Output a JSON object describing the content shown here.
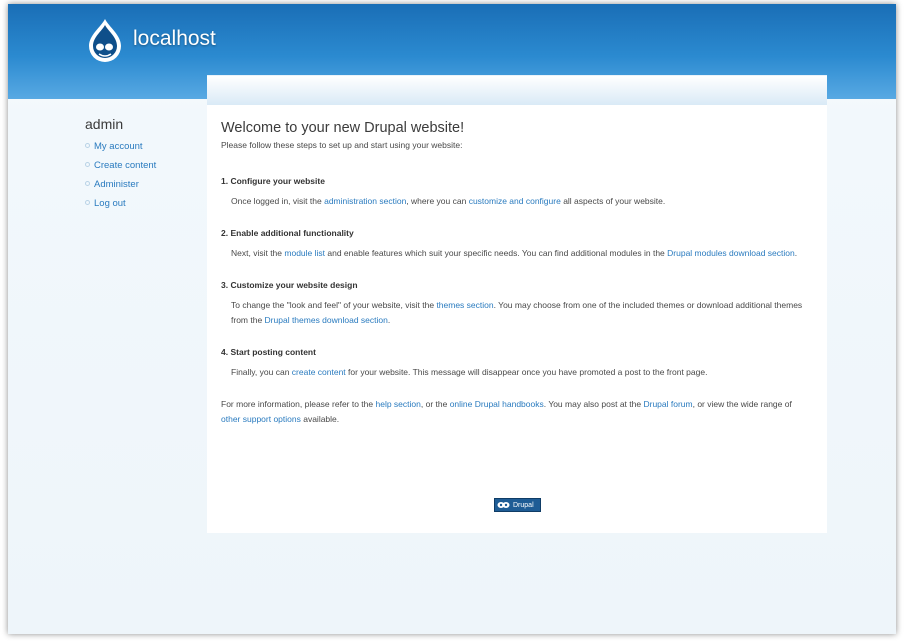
{
  "header": {
    "site_name": "localhost"
  },
  "sidebar": {
    "user": "admin",
    "items": [
      {
        "label": "My account"
      },
      {
        "label": "Create content"
      },
      {
        "label": "Administer"
      },
      {
        "label": "Log out"
      }
    ]
  },
  "main": {
    "title": "Welcome to your new Drupal website!",
    "intro": "Please follow these steps to set up and start using your website:",
    "steps": [
      {
        "number": "1.",
        "title": "Configure your website",
        "t1": "Once logged in, visit the ",
        "l1": "administration section",
        "t2": ", where you can ",
        "l2": "customize and configure",
        "t3": " all aspects of your website."
      },
      {
        "number": "2.",
        "title": "Enable additional functionality",
        "t1": "Next, visit the ",
        "l1": "module list",
        "t2": " and enable features which suit your specific needs. You can find additional modules in the ",
        "l2": "Drupal modules download section",
        "t3": "."
      },
      {
        "number": "3.",
        "title": "Customize your website design",
        "t1": "To change the \"look and feel\" of your website, visit the ",
        "l1": "themes section",
        "t2": ". You may choose from one of the included themes or download additional themes from the ",
        "l2": "Drupal themes download section",
        "t3": "."
      },
      {
        "number": "4.",
        "title": "Start posting content",
        "t1": "Finally, you can ",
        "l1": "create content",
        "t2": " for your website. This message will disappear once you have promoted a post to the front page."
      }
    ],
    "more": {
      "t1": "For more information, please refer to the ",
      "l1": "help section",
      "t2": ", or the ",
      "l2": "online Drupal handbooks",
      "t3": ". You may also post at the ",
      "l3": "Drupal forum",
      "t4": ", or view the wide range of ",
      "l4": "other support options",
      "t5": " available."
    }
  },
  "footer": {
    "badge_label": "Drupal"
  },
  "colors": {
    "header_blue": "#2b8ad0",
    "link": "#2a7bbf",
    "badge": "#1e5c95"
  }
}
